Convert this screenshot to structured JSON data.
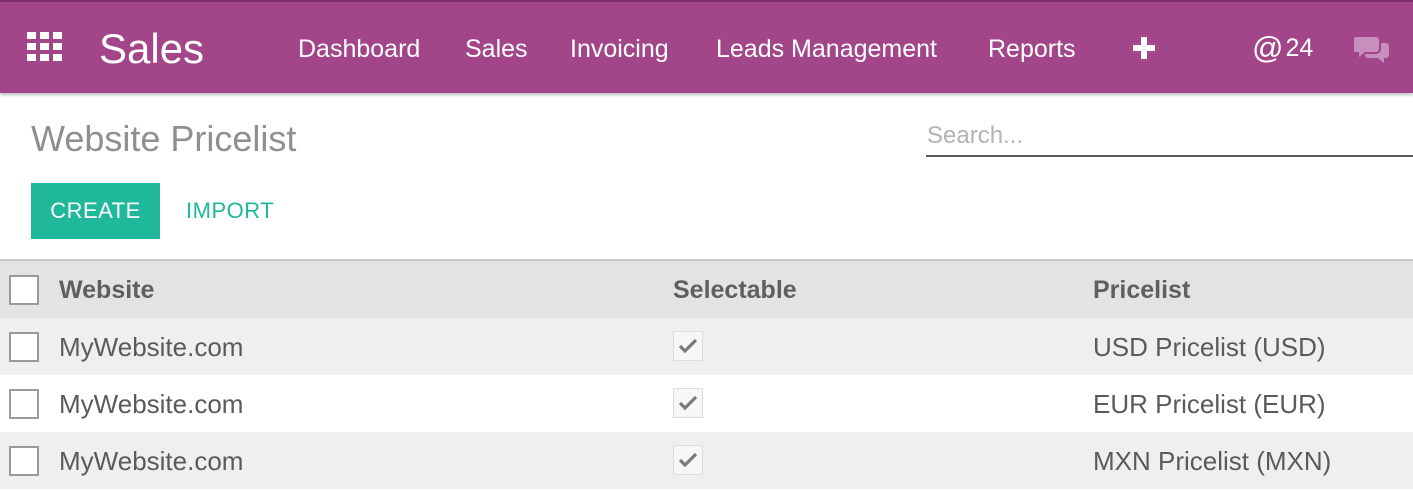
{
  "navbar": {
    "brand": "Sales",
    "menu": [
      "Dashboard",
      "Sales",
      "Invoicing",
      "Leads Management",
      "Reports"
    ],
    "mention_symbol": "@",
    "mention_count": "24",
    "icons": [
      "apps-grid-icon",
      "plus-icon",
      "chat-icon"
    ],
    "background": "#a24689"
  },
  "control_panel": {
    "title": "Website Pricelist",
    "search_placeholder": "Search...",
    "create_label": "CREATE",
    "import_label": "IMPORT",
    "accent": "#1fb89a"
  },
  "table": {
    "headers": {
      "website": "Website",
      "selectable": "Selectable",
      "pricelist": "Pricelist"
    },
    "rows": [
      {
        "website": "MyWebsite.com",
        "selectable": true,
        "pricelist": "USD Pricelist (USD)"
      },
      {
        "website": "MyWebsite.com",
        "selectable": true,
        "pricelist": "EUR Pricelist (EUR)"
      },
      {
        "website": "MyWebsite.com",
        "selectable": true,
        "pricelist": "MXN Pricelist (MXN)"
      }
    ]
  }
}
